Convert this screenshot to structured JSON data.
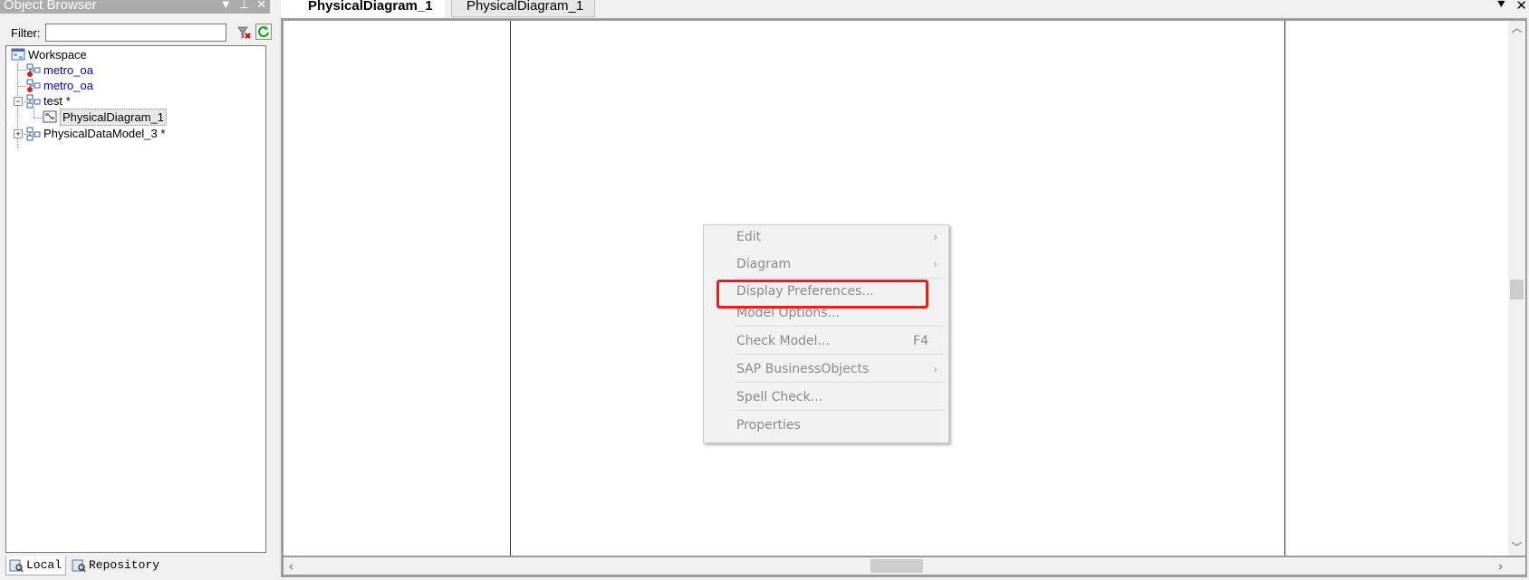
{
  "object_browser": {
    "title": "Object Browser",
    "filter_label": "Filter:",
    "filter_value": "",
    "tree": {
      "workspace": "Workspace",
      "model_1": "metro_oa",
      "model_2": "metro_oa",
      "test": "test *",
      "diagram": "PhysicalDiagram_1",
      "model_3": "PhysicalDataModel_3 *"
    },
    "tabs": {
      "local": "Local",
      "repository": "Repository"
    }
  },
  "document_tabs": {
    "active": "PhysicalDiagram_1",
    "inactive": "PhysicalDiagram_1"
  },
  "context_menu": {
    "edit": "Edit",
    "diagram": "Diagram",
    "display_preferences": "Display Preferences...",
    "model_options": "Model Options...",
    "check_model": "Check Model...",
    "check_model_shortcut": "F4",
    "sap_businessobjects": "SAP BusinessObjects",
    "spell_check": "Spell Check...",
    "properties": "Properties"
  },
  "colors": {
    "highlight_box": "#e8201c",
    "tree_model_link": "#0000cc",
    "menu_text_disabled": "#8a8a8a"
  },
  "icons": {
    "workspace": "workspace-icon",
    "model": "physical-model-icon",
    "diagram": "diagram-icon",
    "local": "local-icon",
    "repository": "repository-icon"
  }
}
